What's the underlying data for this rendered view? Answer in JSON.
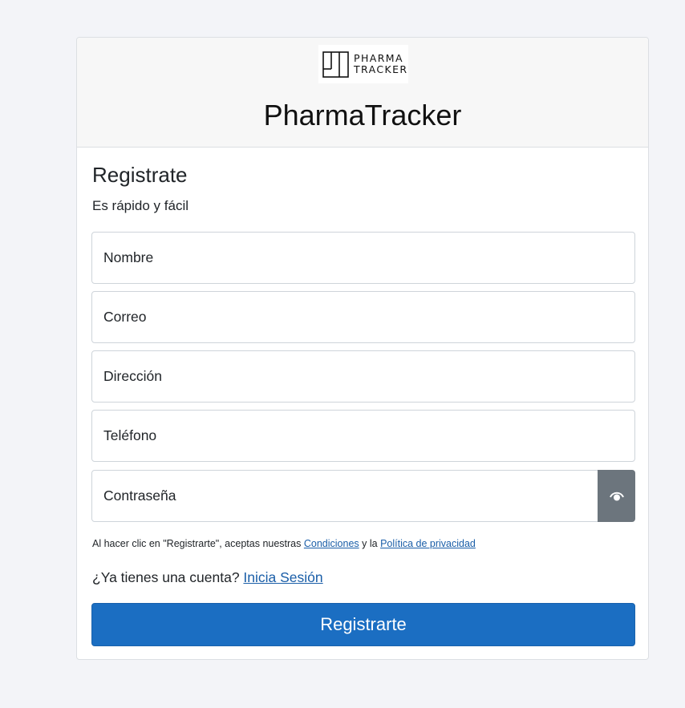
{
  "brand": {
    "logo_line1": "PHARMA",
    "logo_line2": "TRACKER",
    "app_title": "PharmaTracker"
  },
  "form": {
    "title": "Registrate",
    "subtitle": "Es rápido y fácil",
    "fields": {
      "nombre": {
        "placeholder": "Nombre",
        "value": ""
      },
      "correo": {
        "placeholder": "Correo",
        "value": ""
      },
      "direccion": {
        "placeholder": "Dirección",
        "value": ""
      },
      "telefono": {
        "placeholder": "Teléfono",
        "value": ""
      },
      "contrasena": {
        "placeholder": "Contraseña",
        "value": ""
      }
    },
    "password_toggle_icon": "eye-icon",
    "terms": {
      "prefix": "Al hacer clic en \"Registrarte\", aceptas nuestras ",
      "conditions_link": "Condiciones",
      "middle": " y la ",
      "privacy_link": "Política de privacidad"
    },
    "login": {
      "prompt": "¿Ya tienes una cuenta? ",
      "link": "Inicia Sesión"
    },
    "submit_label": "Registrarte"
  },
  "colors": {
    "background": "#f3f4f8",
    "primary_button": "#1b6ec2",
    "toggle_button": "#6c757d",
    "link": "#1a5ea8"
  }
}
